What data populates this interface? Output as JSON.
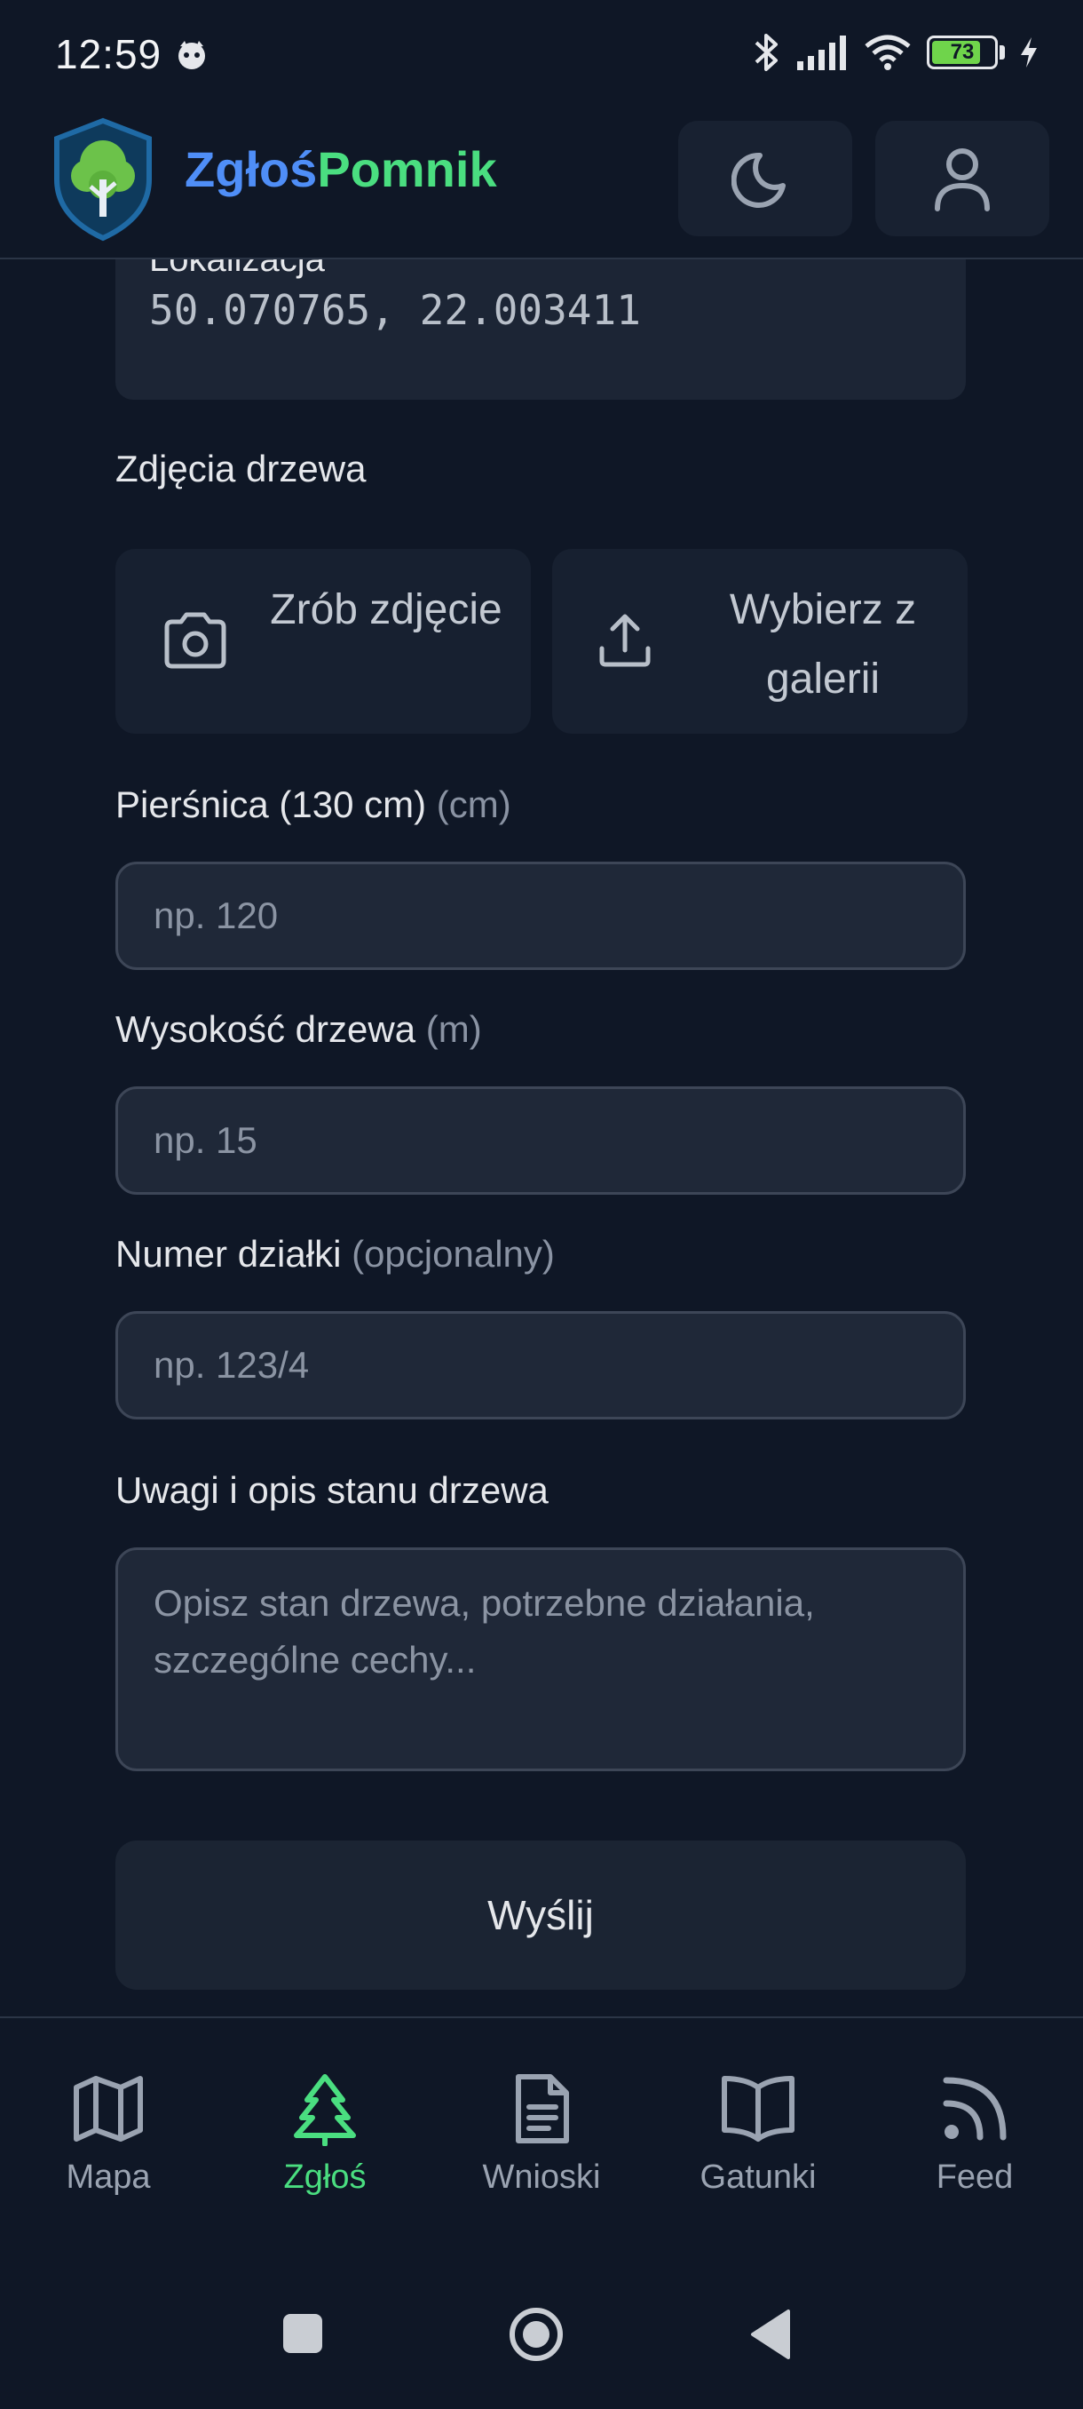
{
  "status_bar": {
    "time": "12:59",
    "battery_level": "73",
    "battery_percent": 73
  },
  "header": {
    "brand_part1": "Zgłoś",
    "brand_part2": "Pomnik"
  },
  "form": {
    "location_label": "Lokalizacja",
    "location_value": "50.070765, 22.003411",
    "photos_label": "Zdjęcia drzewa",
    "take_photo_label": "Zrób zdjęcie",
    "choose_gallery_label": "Wybierz z galerii",
    "circumference_label": "Pierśnica (130 cm)",
    "circumference_unit": "(cm)",
    "circumference_placeholder": "np. 120",
    "height_label": "Wysokość drzewa",
    "height_unit": "(m)",
    "height_placeholder": "np. 15",
    "parcel_label": "Numer działki",
    "parcel_hint": "(opcjonalny)",
    "parcel_placeholder": "np. 123/4",
    "notes_label": "Uwagi i opis stanu drzewa",
    "notes_placeholder": "Opisz stan drzewa, potrzebne działania, szczególne cechy...",
    "submit_label": "Wyślij"
  },
  "bottom_nav": {
    "items": [
      {
        "label": "Mapa",
        "icon": "map-icon",
        "active": false
      },
      {
        "label": "Zgłoś",
        "icon": "tree-icon",
        "active": true
      },
      {
        "label": "Wnioski",
        "icon": "document-icon",
        "active": false
      },
      {
        "label": "Gatunki",
        "icon": "book-icon",
        "active": false
      },
      {
        "label": "Feed",
        "icon": "rss-icon",
        "active": false
      }
    ]
  },
  "colors": {
    "background": "#0f1726",
    "accent_green": "#4ade80",
    "accent_blue": "#4f8ef7",
    "card": "#1c2535"
  }
}
